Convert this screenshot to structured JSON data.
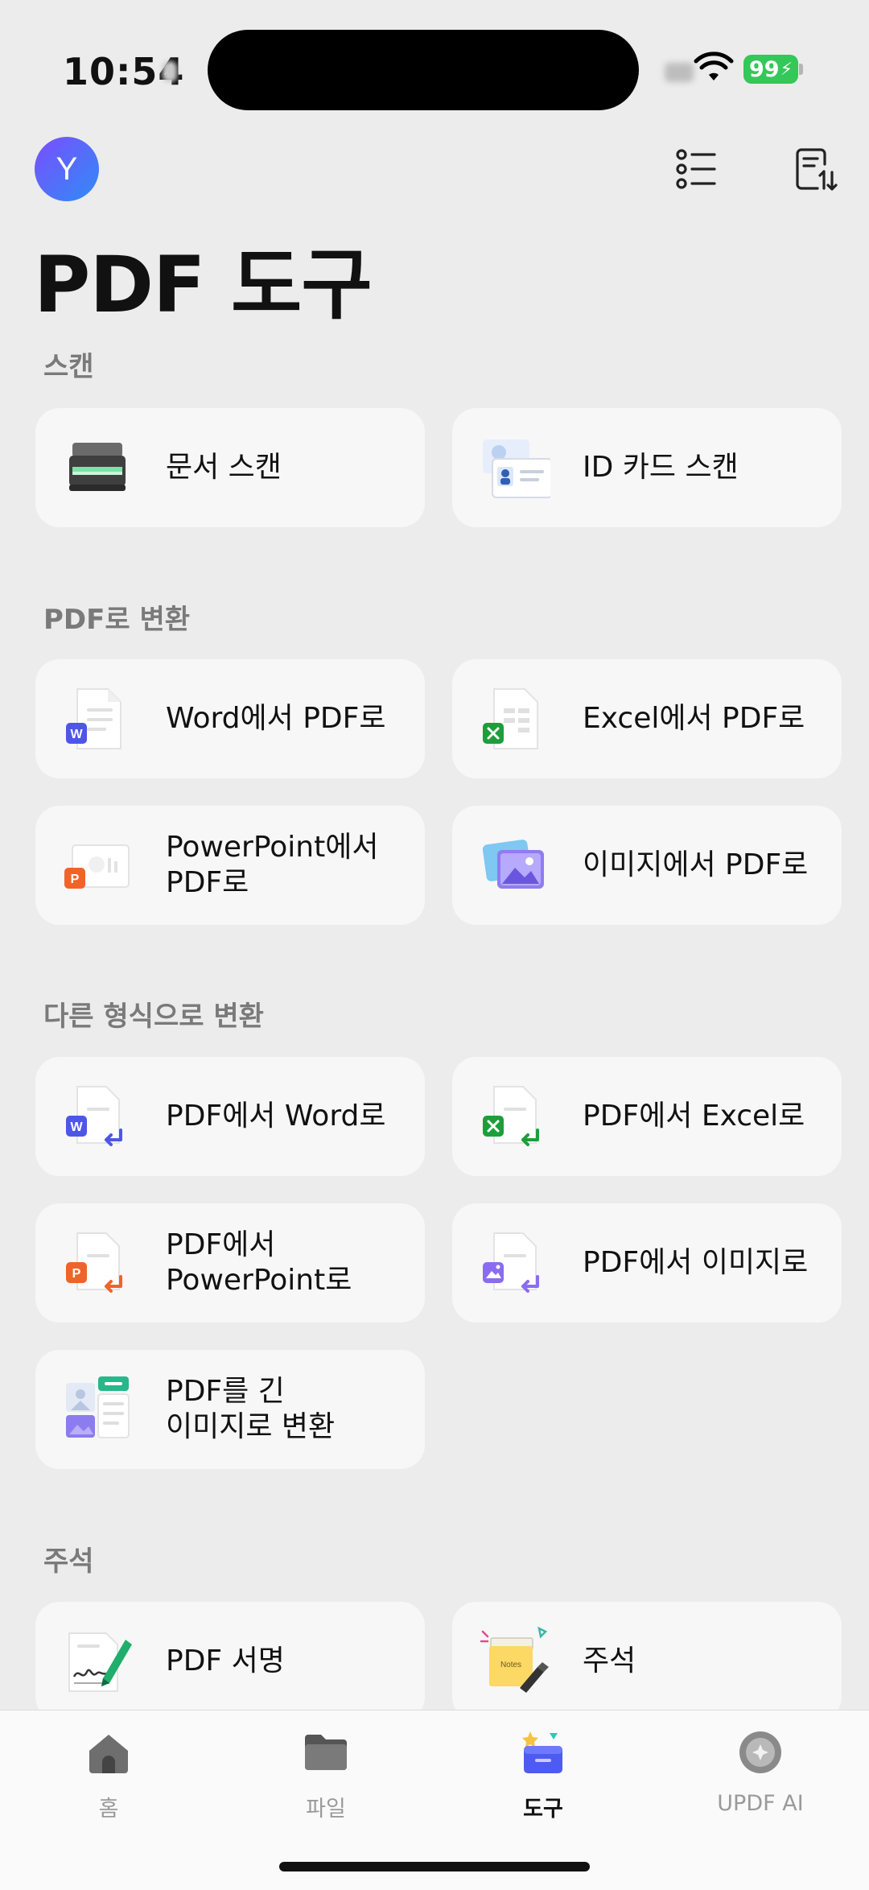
{
  "status_bar": {
    "time": "10:54",
    "battery": "99"
  },
  "header": {
    "avatar_letter": "Y",
    "title": "PDF 도구"
  },
  "sections": [
    {
      "title": "스캔",
      "items": [
        {
          "label": "문서 스캔",
          "icon": "scanner-icon"
        },
        {
          "label": "ID 카드 스캔",
          "icon": "id-card-icon"
        }
      ]
    },
    {
      "title": "PDF로 변환",
      "items": [
        {
          "label": "Word에서 PDF로",
          "icon": "word-doc-icon"
        },
        {
          "label": "Excel에서 PDF로",
          "icon": "excel-doc-icon"
        },
        {
          "label": "PowerPoint에서\nPDF로",
          "icon": "powerpoint-doc-icon"
        },
        {
          "label": "이미지에서 PDF로",
          "icon": "images-icon"
        }
      ]
    },
    {
      "title": "다른 형식으로 변환",
      "items": [
        {
          "label": "PDF에서 Word로",
          "icon": "pdf-to-word-icon"
        },
        {
          "label": "PDF에서 Excel로",
          "icon": "pdf-to-excel-icon"
        },
        {
          "label": "PDF에서\nPowerPoint로",
          "icon": "pdf-to-powerpoint-icon"
        },
        {
          "label": "PDF에서 이미지로",
          "icon": "pdf-to-image-icon"
        },
        {
          "label": "PDF를 긴\n이미지로 변환",
          "icon": "long-image-icon"
        }
      ]
    },
    {
      "title": "주석",
      "items": [
        {
          "label": "PDF 서명",
          "icon": "signature-icon"
        },
        {
          "label": "주석",
          "icon": "sticky-note-icon"
        }
      ]
    }
  ],
  "tabs": [
    {
      "label": "홈",
      "icon": "home-icon",
      "active": false
    },
    {
      "label": "파일",
      "icon": "folder-icon",
      "active": false
    },
    {
      "label": "도구",
      "icon": "tools-icon",
      "active": true
    },
    {
      "label": "UPDF AI",
      "icon": "ai-icon",
      "active": false
    }
  ],
  "colors": {
    "accent": "#4e5bf2",
    "word": "#4e56e8",
    "excel": "#1e9e3a",
    "powerpoint": "#f0642a",
    "image": "#8b6cf0",
    "background": "#ececec",
    "card": "#f7f7f7"
  }
}
